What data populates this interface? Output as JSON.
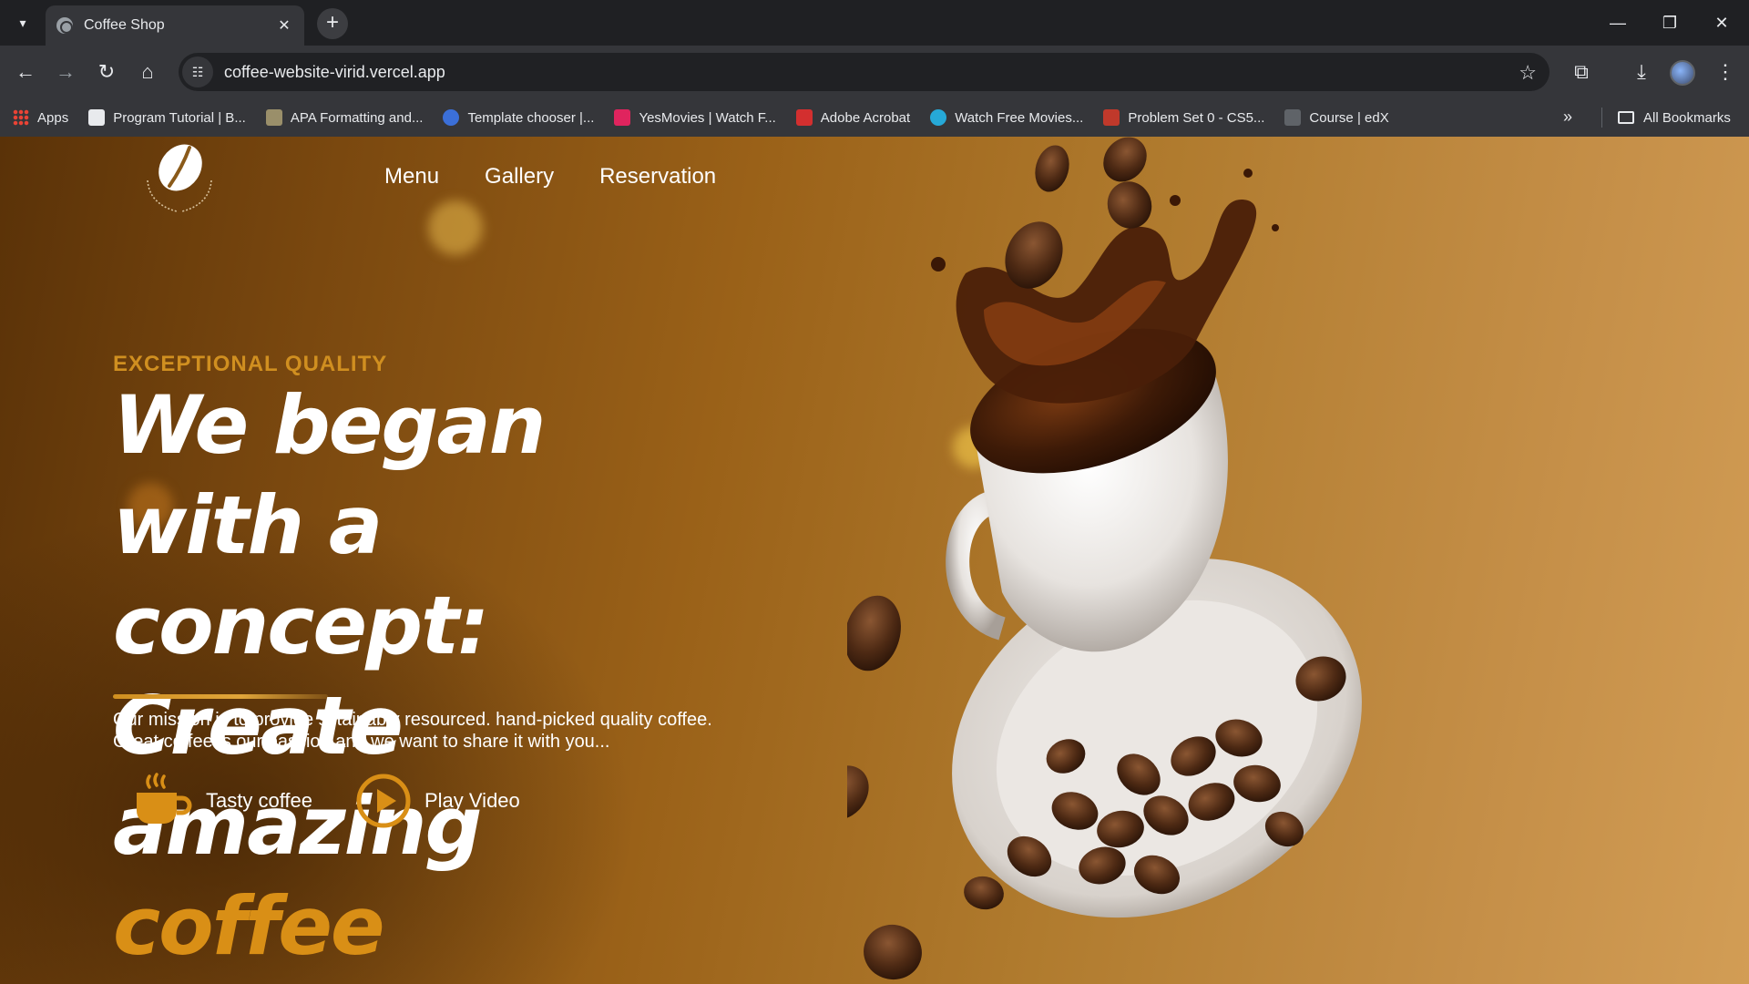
{
  "browser": {
    "tab_title": "Coffee Shop",
    "url": "coffee-website-virid.vercel.app",
    "bookmarks": [
      {
        "label": "Apps",
        "color": "#4285f4"
      },
      {
        "label": "Program Tutorial | B...",
        "color": "#e8eaed"
      },
      {
        "label": "APA Formatting and...",
        "color": "#9a8f6a"
      },
      {
        "label": "Template chooser |...",
        "color": "#3b6fd8"
      },
      {
        "label": "YesMovies | Watch F...",
        "color": "#e0245e"
      },
      {
        "label": "Adobe Acrobat",
        "color": "#d32f2f"
      },
      {
        "label": "Watch Free Movies...",
        "color": "#26a9d8"
      },
      {
        "label": "Problem Set 0 - CS5...",
        "color": "#c0392b"
      },
      {
        "label": "Course | edX",
        "color": "#9aa0a6"
      }
    ],
    "all_bookmarks": "All Bookmarks"
  },
  "nav": {
    "items": [
      "Menu",
      "Gallery",
      "Reservation"
    ]
  },
  "hero": {
    "eyebrow": "EXCEPTIONAL QUALITY",
    "headline_main": "We began with a concept: Create amazing ",
    "headline_accent": "coffee",
    "mission_line1": "Our mission is to provide sstainably resourced. hand-picked quality coffee.",
    "mission_line2": "Great coffee is our passion and we want to share it with you...",
    "cta_tasty": "Tasty coffee",
    "cta_video": "Play Video"
  },
  "colors": {
    "accent": "#d98f16",
    "chrome_dark": "#1f2023",
    "chrome_toolbar": "#35363a"
  }
}
